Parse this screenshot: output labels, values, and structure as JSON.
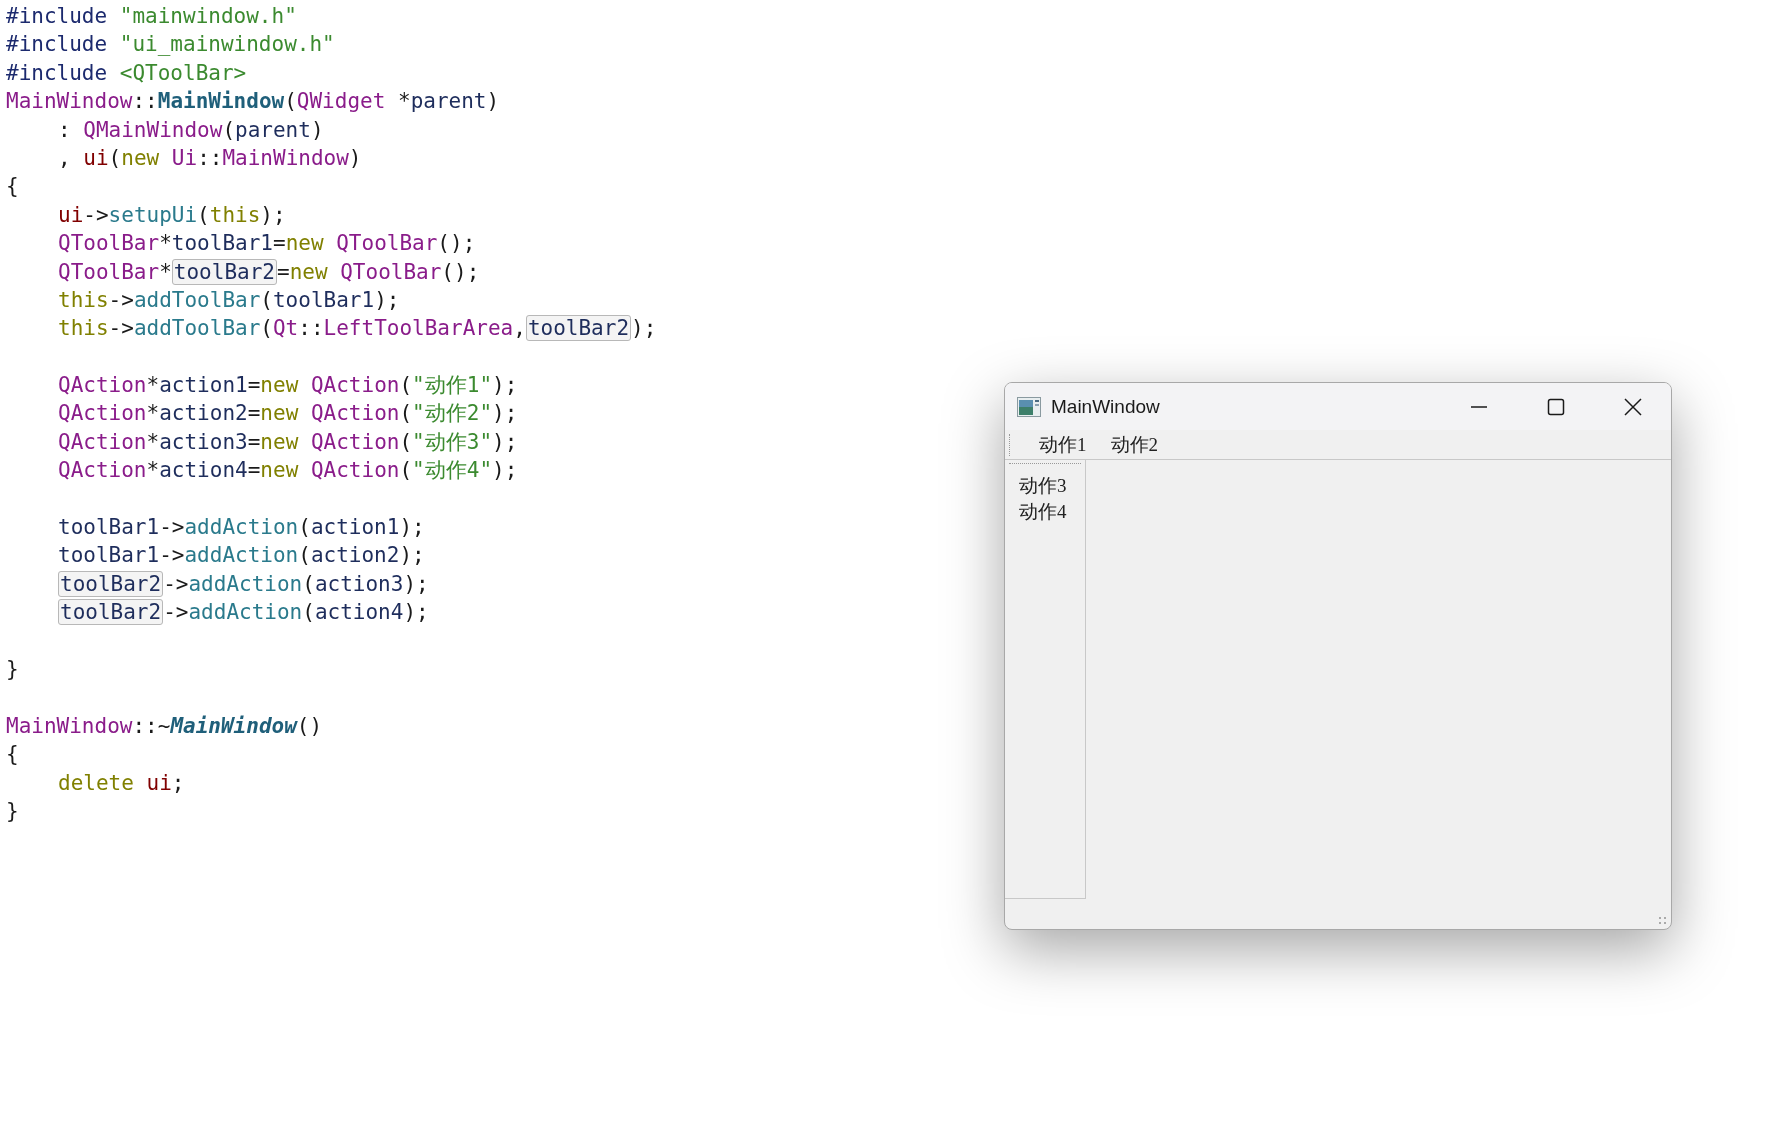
{
  "code_editor": {
    "lines": [
      {
        "tokens": [
          {
            "kind": "directive",
            "text": "#include "
          },
          {
            "kind": "string",
            "text": "\"mainwindow.h\""
          }
        ]
      },
      {
        "tokens": [
          {
            "kind": "directive",
            "text": "#include "
          },
          {
            "kind": "string",
            "text": "\"ui_mainwindow.h\""
          }
        ]
      },
      {
        "tokens": [
          {
            "kind": "directive",
            "text": "#include "
          },
          {
            "kind": "string",
            "text": "<QToolBar>"
          }
        ]
      },
      {
        "tokens": [
          {
            "kind": "type",
            "text": "MainWindow"
          },
          {
            "kind": "punct",
            "text": "::"
          },
          {
            "kind": "function_bold",
            "text": "MainWindow"
          },
          {
            "kind": "punct",
            "text": "("
          },
          {
            "kind": "type",
            "text": "QWidget"
          },
          {
            "kind": "punct",
            "text": " *"
          },
          {
            "kind": "variable",
            "text": "parent"
          },
          {
            "kind": "punct",
            "text": ")"
          }
        ]
      },
      {
        "indent": true,
        "tokens": [
          {
            "kind": "punct",
            "text": ": "
          },
          {
            "kind": "type",
            "text": "QMainWindow"
          },
          {
            "kind": "punct",
            "text": "("
          },
          {
            "kind": "variable",
            "text": "parent"
          },
          {
            "kind": "punct",
            "text": ")"
          }
        ]
      },
      {
        "indent": true,
        "tokens": [
          {
            "kind": "punct",
            "text": ", "
          },
          {
            "kind": "field",
            "text": "ui"
          },
          {
            "kind": "punct",
            "text": "("
          },
          {
            "kind": "keyword",
            "text": "new "
          },
          {
            "kind": "type",
            "text": "Ui"
          },
          {
            "kind": "punct",
            "text": "::"
          },
          {
            "kind": "type",
            "text": "MainWindow"
          },
          {
            "kind": "punct",
            "text": ")"
          }
        ]
      },
      {
        "tokens": [
          {
            "kind": "punct",
            "text": "{"
          }
        ]
      },
      {
        "indent": true,
        "tokens": [
          {
            "kind": "field",
            "text": "ui"
          },
          {
            "kind": "punct",
            "text": "->"
          },
          {
            "kind": "call",
            "text": "setupUi"
          },
          {
            "kind": "punct",
            "text": "("
          },
          {
            "kind": "keyword",
            "text": "this"
          },
          {
            "kind": "punct",
            "text": ");"
          }
        ]
      },
      {
        "indent": true,
        "tokens": [
          {
            "kind": "type",
            "text": "QToolBar"
          },
          {
            "kind": "punct",
            "text": "*"
          },
          {
            "kind": "variable",
            "text": "toolBar1"
          },
          {
            "kind": "punct",
            "text": "="
          },
          {
            "kind": "keyword",
            "text": "new "
          },
          {
            "kind": "type",
            "text": "QToolBar"
          },
          {
            "kind": "punct",
            "text": "();"
          }
        ]
      },
      {
        "indent": true,
        "tokens": [
          {
            "kind": "type",
            "text": "QToolBar"
          },
          {
            "kind": "punct",
            "text": "*"
          },
          {
            "kind": "highlight",
            "text": "toolBar2"
          },
          {
            "kind": "punct",
            "text": "="
          },
          {
            "kind": "keyword",
            "text": "new "
          },
          {
            "kind": "type",
            "text": "QToolBar"
          },
          {
            "kind": "punct",
            "text": "();"
          }
        ]
      },
      {
        "indent": true,
        "tokens": [
          {
            "kind": "keyword",
            "text": "this"
          },
          {
            "kind": "punct",
            "text": "->"
          },
          {
            "kind": "call",
            "text": "addToolBar"
          },
          {
            "kind": "punct",
            "text": "("
          },
          {
            "kind": "variable",
            "text": "toolBar1"
          },
          {
            "kind": "punct",
            "text": ");"
          }
        ]
      },
      {
        "indent": true,
        "tokens": [
          {
            "kind": "keyword",
            "text": "this"
          },
          {
            "kind": "punct",
            "text": "->"
          },
          {
            "kind": "call",
            "text": "addToolBar"
          },
          {
            "kind": "punct",
            "text": "("
          },
          {
            "kind": "type",
            "text": "Qt"
          },
          {
            "kind": "punct",
            "text": "::"
          },
          {
            "kind": "type",
            "text": "LeftToolBarArea"
          },
          {
            "kind": "punct",
            "text": ","
          },
          {
            "kind": "highlight",
            "text": "toolBar2"
          },
          {
            "kind": "punct",
            "text": ");"
          }
        ]
      },
      {
        "indent": true,
        "gap_before": true,
        "tokens": [
          {
            "kind": "type",
            "text": "QAction"
          },
          {
            "kind": "punct",
            "text": "*"
          },
          {
            "kind": "variable",
            "text": "action1"
          },
          {
            "kind": "punct",
            "text": "="
          },
          {
            "kind": "keyword",
            "text": "new "
          },
          {
            "kind": "type",
            "text": "QAction"
          },
          {
            "kind": "punct",
            "text": "("
          },
          {
            "kind": "string",
            "text": "\"动作1\""
          },
          {
            "kind": "punct",
            "text": ");"
          }
        ]
      },
      {
        "indent": true,
        "tokens": [
          {
            "kind": "type",
            "text": "QAction"
          },
          {
            "kind": "punct",
            "text": "*"
          },
          {
            "kind": "variable",
            "text": "action2"
          },
          {
            "kind": "punct",
            "text": "="
          },
          {
            "kind": "keyword",
            "text": "new "
          },
          {
            "kind": "type",
            "text": "QAction"
          },
          {
            "kind": "punct",
            "text": "("
          },
          {
            "kind": "string",
            "text": "\"动作2\""
          },
          {
            "kind": "punct",
            "text": ");"
          }
        ]
      },
      {
        "indent": true,
        "tokens": [
          {
            "kind": "type",
            "text": "QAction"
          },
          {
            "kind": "punct",
            "text": "*"
          },
          {
            "kind": "variable",
            "text": "action3"
          },
          {
            "kind": "punct",
            "text": "="
          },
          {
            "kind": "keyword",
            "text": "new "
          },
          {
            "kind": "type",
            "text": "QAction"
          },
          {
            "kind": "punct",
            "text": "("
          },
          {
            "kind": "string",
            "text": "\"动作3\""
          },
          {
            "kind": "punct",
            "text": ");"
          }
        ]
      },
      {
        "indent": true,
        "tokens": [
          {
            "kind": "type",
            "text": "QAction"
          },
          {
            "kind": "punct",
            "text": "*"
          },
          {
            "kind": "variable",
            "text": "action4"
          },
          {
            "kind": "punct",
            "text": "="
          },
          {
            "kind": "keyword",
            "text": "new "
          },
          {
            "kind": "type",
            "text": "QAction"
          },
          {
            "kind": "punct",
            "text": "("
          },
          {
            "kind": "string",
            "text": "\"动作4\""
          },
          {
            "kind": "punct",
            "text": ");"
          }
        ]
      },
      {
        "indent": true,
        "gap_before": true,
        "tokens": [
          {
            "kind": "variable",
            "text": "toolBar1"
          },
          {
            "kind": "punct",
            "text": "->"
          },
          {
            "kind": "call",
            "text": "addAction"
          },
          {
            "kind": "punct",
            "text": "("
          },
          {
            "kind": "variable",
            "text": "action1"
          },
          {
            "kind": "punct",
            "text": ");"
          }
        ]
      },
      {
        "indent": true,
        "tokens": [
          {
            "kind": "variable",
            "text": "toolBar1"
          },
          {
            "kind": "punct",
            "text": "->"
          },
          {
            "kind": "call",
            "text": "addAction"
          },
          {
            "kind": "punct",
            "text": "("
          },
          {
            "kind": "variable",
            "text": "action2"
          },
          {
            "kind": "punct",
            "text": ");"
          }
        ]
      },
      {
        "indent": true,
        "tokens": [
          {
            "kind": "highlight",
            "text": "toolBar2"
          },
          {
            "kind": "punct",
            "text": "->"
          },
          {
            "kind": "call",
            "text": "addAction"
          },
          {
            "kind": "punct",
            "text": "("
          },
          {
            "kind": "variable",
            "text": "action3"
          },
          {
            "kind": "punct",
            "text": ");"
          }
        ]
      },
      {
        "indent": true,
        "tokens": [
          {
            "kind": "highlight",
            "text": "toolBar2"
          },
          {
            "kind": "punct",
            "text": "->"
          },
          {
            "kind": "call",
            "text": "addAction"
          },
          {
            "kind": "punct",
            "text": "("
          },
          {
            "kind": "variable",
            "text": "action4"
          },
          {
            "kind": "punct",
            "text": ");"
          }
        ]
      },
      {
        "gap_before": true,
        "tokens": [
          {
            "kind": "punct",
            "text": "}"
          }
        ]
      },
      {
        "gap_before": true,
        "tokens": [
          {
            "kind": "type",
            "text": "MainWindow"
          },
          {
            "kind": "punct",
            "text": "::~"
          },
          {
            "kind": "function_italic",
            "text": "MainWindow"
          },
          {
            "kind": "punct",
            "text": "()"
          }
        ]
      },
      {
        "tokens": [
          {
            "kind": "punct",
            "text": "{"
          }
        ]
      },
      {
        "indent": true,
        "tokens": [
          {
            "kind": "keyword",
            "text": "delete "
          },
          {
            "kind": "field",
            "text": "ui"
          },
          {
            "kind": "punct",
            "text": ";"
          }
        ]
      },
      {
        "tokens": [
          {
            "kind": "punct",
            "text": "}"
          }
        ]
      }
    ]
  },
  "window": {
    "title": "MainWindow",
    "top_toolbar": {
      "actions": [
        "动作1",
        "动作2"
      ]
    },
    "left_toolbar": {
      "actions": [
        "动作3",
        "动作4"
      ]
    }
  }
}
